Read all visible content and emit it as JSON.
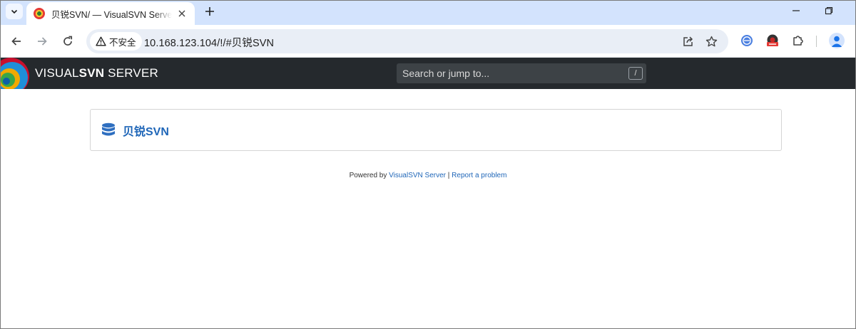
{
  "browser": {
    "tab": {
      "title": "贝锐SVN/ — VisualSVN Server"
    },
    "address_bar": {
      "security_label": "不安全",
      "url": "10.168.123.104/!/#贝锐SVN"
    }
  },
  "app": {
    "brand": {
      "part1": "VISUAL",
      "part2": "SVN",
      "part3": " SERVER"
    },
    "search": {
      "placeholder": "Search or jump to...",
      "shortcut": "/"
    }
  },
  "main": {
    "repository": {
      "name": "贝锐SVN",
      "icon": "database-icon"
    }
  },
  "footer": {
    "powered_by": "Powered by ",
    "product_link": "VisualSVN Server",
    "separator": " | ",
    "report_link": "Report a problem"
  },
  "colors": {
    "tab_strip": "#d3e3fd",
    "app_header": "#25292d",
    "link_blue": "#1f66b8"
  }
}
